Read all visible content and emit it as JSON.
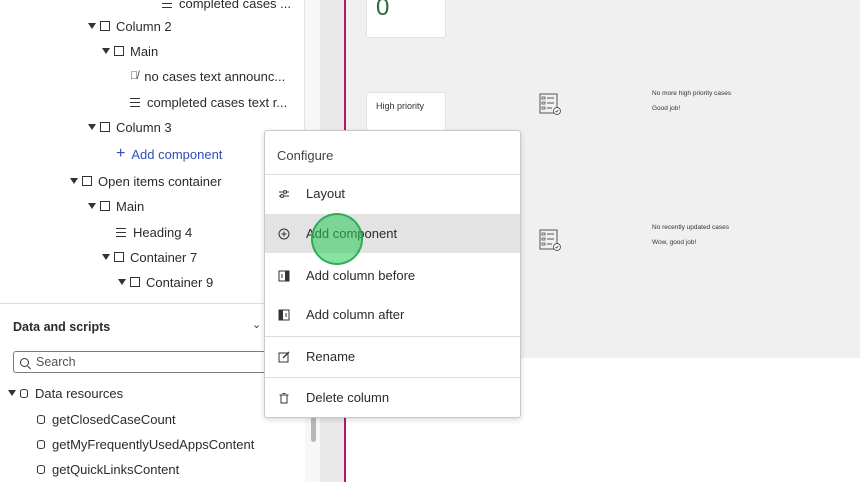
{
  "tree": {
    "items": [
      {
        "label": "completed cases ..."
      },
      {
        "label": "Column 2"
      },
      {
        "label": "Main"
      },
      {
        "label": "no cases text announc..."
      },
      {
        "label": "completed cases text r..."
      },
      {
        "label": "Column 3"
      },
      {
        "label": "Add component"
      },
      {
        "label": "Open items container"
      },
      {
        "label": "Main"
      },
      {
        "label": "Heading 4"
      },
      {
        "label": "Container 7"
      },
      {
        "label": "Container 9"
      }
    ]
  },
  "data_scripts": {
    "title": "Data and scripts",
    "search_placeholder": "Search",
    "group_label": "Data resources",
    "resources": [
      {
        "label": "getClosedCaseCount"
      },
      {
        "label": "getMyFrequentlyUsedAppsContent"
      },
      {
        "label": "getQuickLinksContent"
      }
    ]
  },
  "canvas": {
    "zero_value": "0",
    "high_priority_label": "High priority",
    "empty_states": [
      {
        "title": "No more high priority cases",
        "subtitle": "Good job!"
      },
      {
        "title": "No recently updated cases",
        "subtitle": "Wow, good job!"
      }
    ]
  },
  "menu": {
    "header": "Configure",
    "items": [
      {
        "label": "Layout",
        "icon": "sliders-icon"
      },
      {
        "label": "Add component",
        "icon": "add-circle-icon"
      },
      {
        "label": "Add column before",
        "icon": "add-column-before-icon"
      },
      {
        "label": "Add column after",
        "icon": "add-column-after-icon"
      },
      {
        "label": "Rename",
        "icon": "edit-icon"
      },
      {
        "label": "Delete column",
        "icon": "trash-icon"
      }
    ]
  },
  "colors": {
    "accent": "#2e4fb8",
    "rule": "#b0186e",
    "highlight": "#e3e3e3"
  }
}
